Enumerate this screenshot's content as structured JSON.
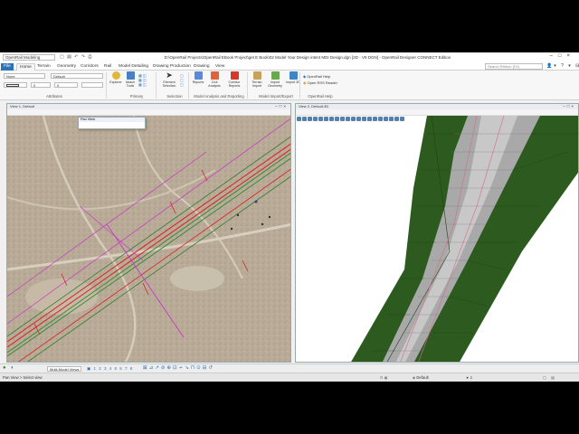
{
  "titlebar": {
    "workspace": "OpenRail Modeling",
    "title": "D:\\OpenRail Projects\\OpenRail EBook Project\\get E Book\\02 Model Your Design intent MDI Design.dgn [2D - V8 DGN] - OpenRail Designer CONNECT Edition"
  },
  "tabs": [
    {
      "label": "File"
    },
    {
      "label": "Home"
    },
    {
      "label": "Terrain"
    },
    {
      "label": "Geometry"
    },
    {
      "label": "Corridors"
    },
    {
      "label": "Rail"
    },
    {
      "label": "Model Detailing"
    },
    {
      "label": "Drawing Production"
    },
    {
      "label": "Drawing"
    },
    {
      "label": "View"
    }
  ],
  "search_placeholder": "Search Ribbon (F4)",
  "ribbon": {
    "attributes": {
      "level": "None",
      "style": "Default",
      "weight": "0",
      "color": "0",
      "group_label": "Attributes"
    },
    "primary": {
      "explorer": "Explorer",
      "attach_tools": "Attach Tools",
      "group_label": "Primary"
    },
    "selection": {
      "element_selection": "Element Selection",
      "group_label": "Selection"
    },
    "analysis": {
      "reports": "Reports",
      "civil_analysis": "Civil Analysis",
      "corridor_reports": "Corridor Reports",
      "group_label": "Model Analysis and Reporting"
    },
    "import_export": {
      "terrain_import": "Terrain Import",
      "import_geometry": "Import Geometry",
      "import_3d": "Import 3D",
      "group_label": "Model Import/Export"
    },
    "help": {
      "openrail_help": "OpenRail Help",
      "openrail_rss": "Open RSS Reader",
      "group_label": "OpenRail Help"
    }
  },
  "views": {
    "left_title": "View 1, Default",
    "right_title": "View 2, Default-3D",
    "pan_view": "Pan View"
  },
  "bottom_toolbar": {
    "model_dropdown": "Multi-Model Views"
  },
  "status": {
    "left": "Pan View > Select view",
    "level": "Default",
    "page": "1"
  },
  "colors": {
    "file_tab": "#2b73b6",
    "terrain_green": "#2d5a1f",
    "track_gray": "#a9a9a9",
    "alignment_red": "#d42020",
    "alignment_magenta": "#c832c8"
  }
}
